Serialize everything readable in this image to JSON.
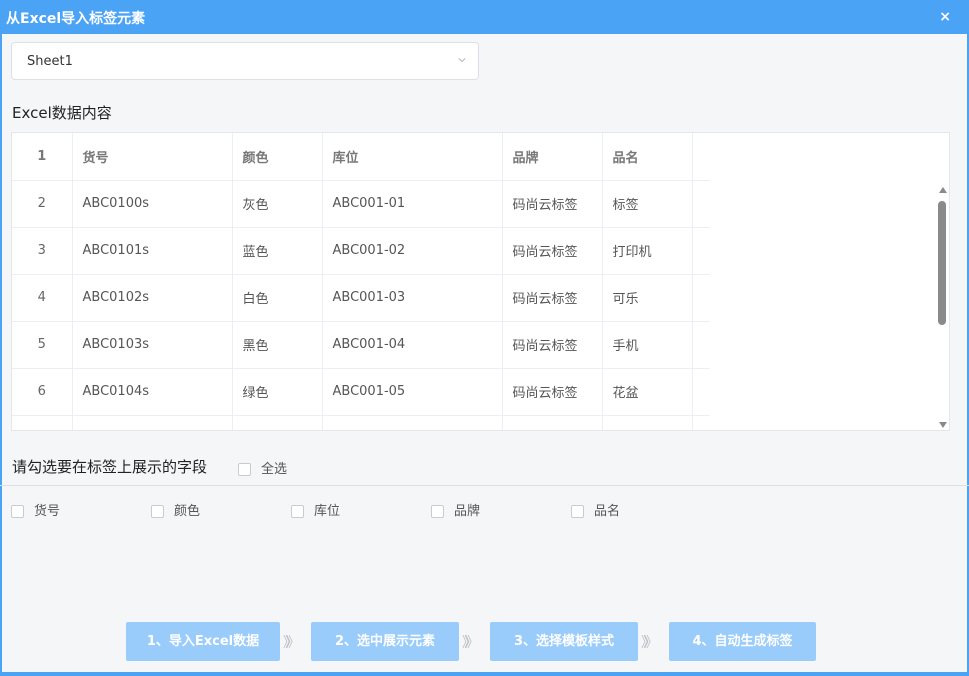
{
  "window": {
    "title": "从Excel导入标签元素",
    "close_icon": "×"
  },
  "sheet_select": {
    "value": "Sheet1"
  },
  "excel_section": {
    "label": "Excel数据内容"
  },
  "table": {
    "header": [
      "1",
      "货号",
      "颜色",
      "库位",
      "品牌",
      "品名"
    ],
    "rows": [
      [
        "2",
        "ABC0100s",
        "灰色",
        "ABC001-01",
        "码尚云标签",
        "标签"
      ],
      [
        "3",
        "ABC0101s",
        "蓝色",
        "ABC001-02",
        "码尚云标签",
        "打印机"
      ],
      [
        "4",
        "ABC0102s",
        "白色",
        "ABC001-03",
        "码尚云标签",
        "可乐"
      ],
      [
        "5",
        "ABC0103s",
        "黑色",
        "ABC001-04",
        "码尚云标签",
        "手机"
      ],
      [
        "6",
        "ABC0104s",
        "绿色",
        "ABC001-05",
        "码尚云标签",
        "花盆"
      ],
      [
        "",
        "",
        "",
        "",
        "",
        ""
      ]
    ]
  },
  "fields_section": {
    "label": "请勾选要在标签上展示的字段",
    "select_all": "全选"
  },
  "fields": [
    "货号",
    "颜色",
    "库位",
    "品牌",
    "品名"
  ],
  "steps": [
    "1、导入Excel数据",
    "2、选中展示元素",
    "3、选择模板样式",
    "4、自动生成标签"
  ],
  "step_separator": "》》",
  "colors": {
    "accent": "#4aa3f5",
    "step_button": "#99ccfa"
  }
}
